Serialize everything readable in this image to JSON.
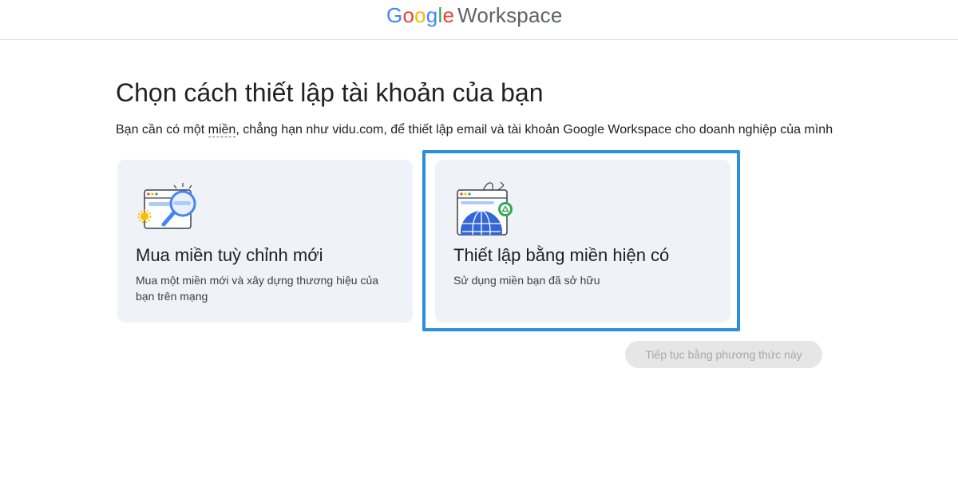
{
  "header": {
    "logo_letters": [
      "G",
      "o",
      "o",
      "g",
      "l",
      "e"
    ],
    "logo_product": "Workspace"
  },
  "main": {
    "title": "Chọn cách thiết lập tài khoản của bạn",
    "subtitle_before": "Bạn cần có một ",
    "subtitle_term": "miền",
    "subtitle_after": ", chẳng hạn như vidu.com, để thiết lập email và tài khoản Google Workspace cho doanh nghiệp của mình"
  },
  "options": [
    {
      "icon": "domain-search-icon",
      "title": "Mua miền tuỳ chỉnh mới",
      "description": "Mua một miền mới và xây dựng thương hiệu của bạn trên mạng",
      "selected": false
    },
    {
      "icon": "globe-domain-icon",
      "title": "Thiết lập bằng miền hiện có",
      "description": "Sử dụng miền bạn đã sở hữu",
      "selected": true
    }
  ],
  "actions": {
    "continue_label": "Tiếp tục bằng phương thức này",
    "continue_enabled": false
  },
  "colors": {
    "google_blue": "#4285f4",
    "google_red": "#ea4335",
    "google_yellow": "#fbbc05",
    "google_green": "#34a853",
    "selection_outline": "#2a8fdf",
    "card_background": "#eff2f7"
  }
}
